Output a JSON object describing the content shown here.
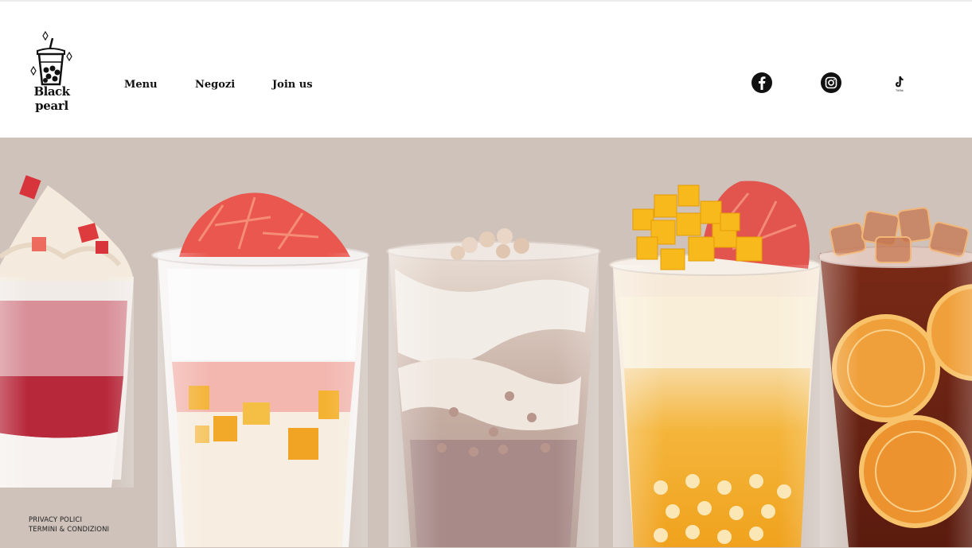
{
  "brand": {
    "logo_line1": "Black",
    "logo_line2": "pearl"
  },
  "nav": {
    "items": [
      {
        "label": "Menu"
      },
      {
        "label": "Negozi"
      },
      {
        "label": "Join us"
      }
    ]
  },
  "social": {
    "icons": [
      "facebook-icon",
      "instagram-icon",
      "tiktok-icon"
    ],
    "tiktok_caption": "TikTok"
  },
  "hero": {
    "background_color": "#cec2ba",
    "products": [
      "strawberry-cream-drink",
      "grapefruit-mango-sago-drink",
      "taro-milk-drink",
      "mango-grapefruit-boba-drink",
      "lemon-black-tea-drink"
    ]
  },
  "footer": {
    "privacy_label": "PRIVACY POLICI",
    "terms_label": "TERMINI & CONDIZIONI"
  }
}
